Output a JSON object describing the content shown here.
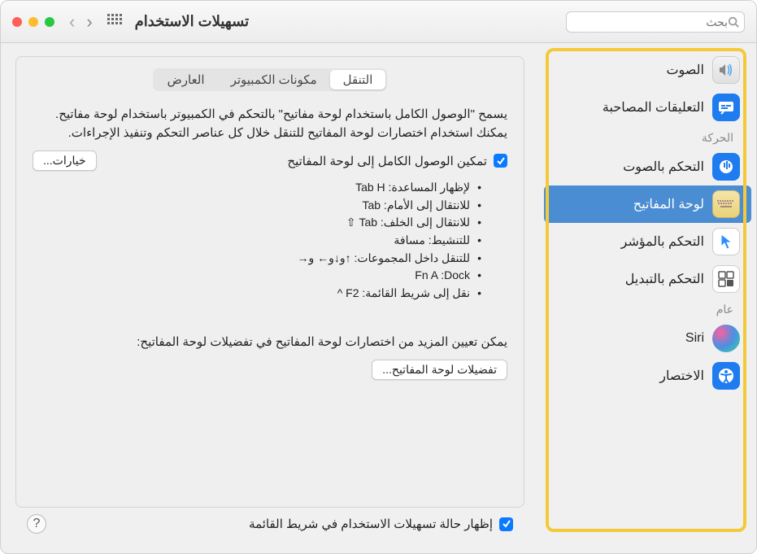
{
  "window": {
    "title": "تسهيلات الاستخدام",
    "search_placeholder": "بحث"
  },
  "sidebar": {
    "items": [
      {
        "label": "الصوت",
        "section": null
      },
      {
        "label": "التعليقات المصاحبة",
        "section": null
      }
    ],
    "section_motion": "الحركة",
    "motion_items": [
      {
        "label": "التحكم بالصوت"
      },
      {
        "label": "لوحة المفاتيح"
      },
      {
        "label": "التحكم بالمؤشر"
      },
      {
        "label": "التحكم بالتبديل"
      }
    ],
    "section_general": "عام",
    "general_items": [
      {
        "label": "Siri"
      },
      {
        "label": "الاختصار"
      }
    ]
  },
  "tabs": {
    "nav": "التنقل",
    "hw": "مكونات الكمبيوتر",
    "viewer": "العارض"
  },
  "panel": {
    "description": "يسمح \"الوصول الكامل باستخدام لوحة مفاتيح\" بالتحكم في الكمبيوتر باستخدام لوحة مفاتيح. يمكنك استخدام اختصارات لوحة المفاتيح للتنقل خلال كل عناصر التحكم وتنفيذ الإجراءات.",
    "checkbox_label": "تمكين الوصول الكامل إلى لوحة المفاتيح",
    "options_btn": "خيارات...",
    "bullets": [
      "لإظهار المساعدة: Tab H",
      "للانتقال إلى الأمام: Tab",
      "للانتقال إلى الخلف: Tab ⇧",
      "للتنشيط: مسافة",
      "للتنقل داخل المجموعات: ↑و↓و← و→",
      "Fn A :Dock",
      "نقل إلى شريط القائمة: F2 ^"
    ],
    "more_text": "يمكن تعيين المزيد من اختصارات لوحة المفاتيح في تفضيلات لوحة المفاتيح:",
    "prefs_btn": "تفضيلات لوحة المفاتيح..."
  },
  "footer": {
    "show_status": "إظهار حالة تسهيلات الاستخدام في شريط القائمة"
  }
}
